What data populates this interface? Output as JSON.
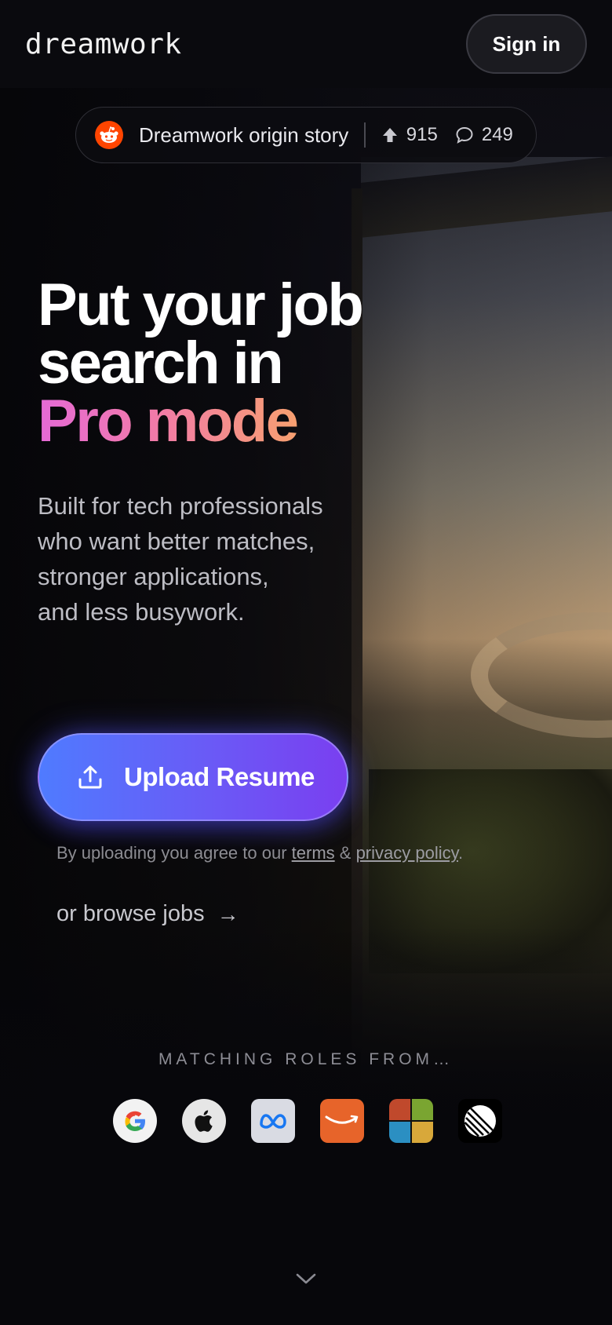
{
  "brand": {
    "logo_text": "dreamwork"
  },
  "header": {
    "signin_label": "Sign in"
  },
  "story_pill": {
    "title": "Dreamwork origin story",
    "upvotes": "915",
    "comments": "249",
    "icon": "reddit-icon"
  },
  "hero": {
    "headline_line1": "Put your job",
    "headline_line2": "search in",
    "headline_accent": "Pro mode",
    "sub_line1": "Built for tech professionals",
    "sub_line2": "who want better matches,",
    "sub_line3": "stronger applications,",
    "sub_line4": "and less busywork."
  },
  "cta": {
    "upload_label": "Upload Resume",
    "agree_prefix": "By uploading you agree to our ",
    "terms_label": "terms",
    "amp": " & ",
    "privacy_label": "privacy policy",
    "period": ".",
    "browse_label": "or browse jobs",
    "browse_arrow": "→"
  },
  "matching": {
    "heading": "MATCHING ROLES FROM…",
    "companies": [
      "google-logo",
      "apple-logo",
      "meta-logo",
      "amazon-logo",
      "microsoft-logo",
      "linear-logo"
    ]
  },
  "colors": {
    "accent_start": "#4f7bff",
    "accent_end": "#7a3ff0",
    "gradient_text_start": "#e56ad6",
    "gradient_text_end": "#f7a070",
    "reddit": "#ff4500"
  }
}
